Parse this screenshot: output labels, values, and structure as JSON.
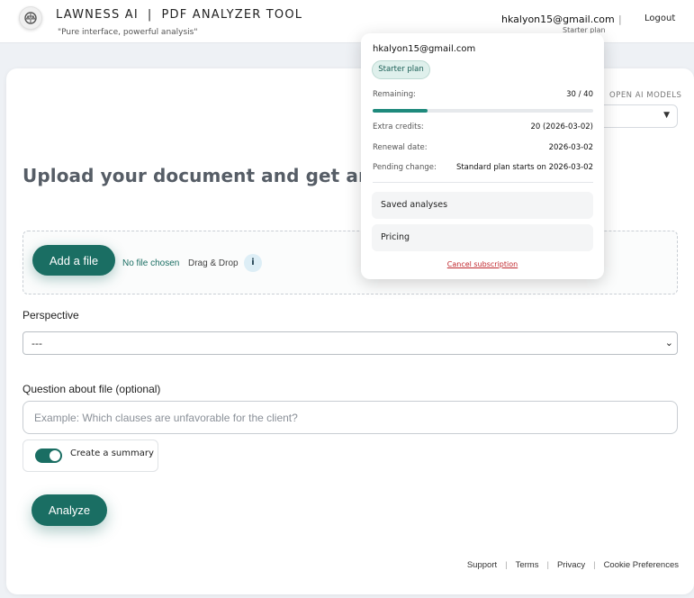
{
  "header": {
    "brand_left": "LAWNESS AI",
    "brand_sep": "|",
    "brand_right": "PDF ANALYZER TOOL",
    "tagline": "\"Pure interface, powerful analysis\"",
    "user_email": "hkalyon15@gmail.com",
    "user_plan": "Starter plan",
    "divider": "|",
    "logout_label": "Logout"
  },
  "models": {
    "label": "OPEN AI MODELS",
    "selected": ""
  },
  "main": {
    "headline": "Upload your document and get an AI-po",
    "add_file_label": "Add a file",
    "no_file_text": "No file chosen",
    "drag_drop_text": "Drag & Drop",
    "info_label": "i",
    "perspective_label": "Perspective",
    "perspective_value": "---",
    "question_label": "Question about file (optional)",
    "question_placeholder": "Example: Which clauses are unfavorable for the client?",
    "summary_label": "Create a summary",
    "summary_enabled": true,
    "analyze_label": "Analyze"
  },
  "footer": {
    "links": [
      "Support",
      "Terms",
      "Privacy",
      "Cookie Preferences"
    ],
    "sep": "|"
  },
  "account_menu": {
    "email": "hkalyon15@gmail.com",
    "plan_badge": "Starter plan",
    "remaining_label": "Remaining:",
    "remaining_value": "30 / 40",
    "remaining_fraction": 0.25,
    "extra_credits_label": "Extra credits:",
    "extra_credits_value": "20 (2026-03-02)",
    "renewal_label": "Renewal date:",
    "renewal_value": "2026-03-02",
    "pending_label": "Pending change:",
    "pending_value": "Standard plan starts on 2026-03-02",
    "saved_analyses_label": "Saved analyses",
    "pricing_label": "Pricing",
    "cancel_label": "Cancel subscription"
  },
  "colors": {
    "accent": "#1a6e63",
    "progress": "#1e8a7c",
    "danger": "#c0272d"
  }
}
